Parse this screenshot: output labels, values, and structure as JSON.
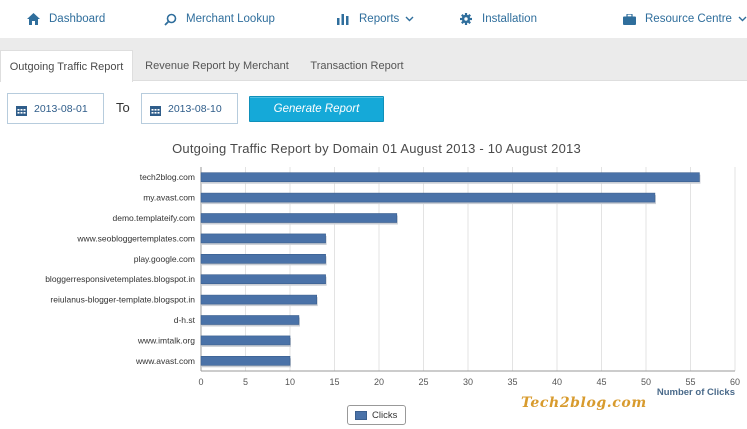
{
  "nav": {
    "dashboard": "Dashboard",
    "merchant_lookup": "Merchant Lookup",
    "reports": "Reports",
    "installation": "Installation",
    "resource_centre": "Resource Centre"
  },
  "tabs": [
    "Outgoing Traffic Report",
    "Revenue Report by Merchant",
    "Transaction Report"
  ],
  "filter": {
    "from_date": "2013-08-01",
    "to_label": "To",
    "to_date": "2013-08-10",
    "generate_label": "Generate Report"
  },
  "colors": {
    "accent": "#2f6e9c",
    "button": "#15a9d8",
    "bar": "#4a72a8"
  },
  "chart_data": {
    "type": "bar",
    "orientation": "horizontal",
    "title": "Outgoing Traffic Report by Domain 01 August 2013 - 10 August 2013",
    "xlabel": "Number of Clicks",
    "ylabel": "",
    "xlim": [
      0,
      60
    ],
    "xticks": [
      0,
      5,
      10,
      15,
      20,
      25,
      30,
      35,
      40,
      45,
      50,
      55,
      60
    ],
    "grid": true,
    "legend": "bottom-center",
    "categories": [
      "tech2blog.com",
      "my.avast.com",
      "demo.templateify.com",
      "www.seobloggertemplates.com",
      "play.google.com",
      "bloggerresponsivetemplates.blogspot.in",
      "reiulanus-blogger-template.blogspot.in",
      "d-h.st",
      "www.imtalk.org",
      "www.avast.com"
    ],
    "series": [
      {
        "name": "Clicks",
        "values": [
          56,
          51,
          22,
          14,
          14,
          14,
          13,
          11,
          10,
          10
        ]
      }
    ]
  },
  "watermark": "Tech2blog.com"
}
